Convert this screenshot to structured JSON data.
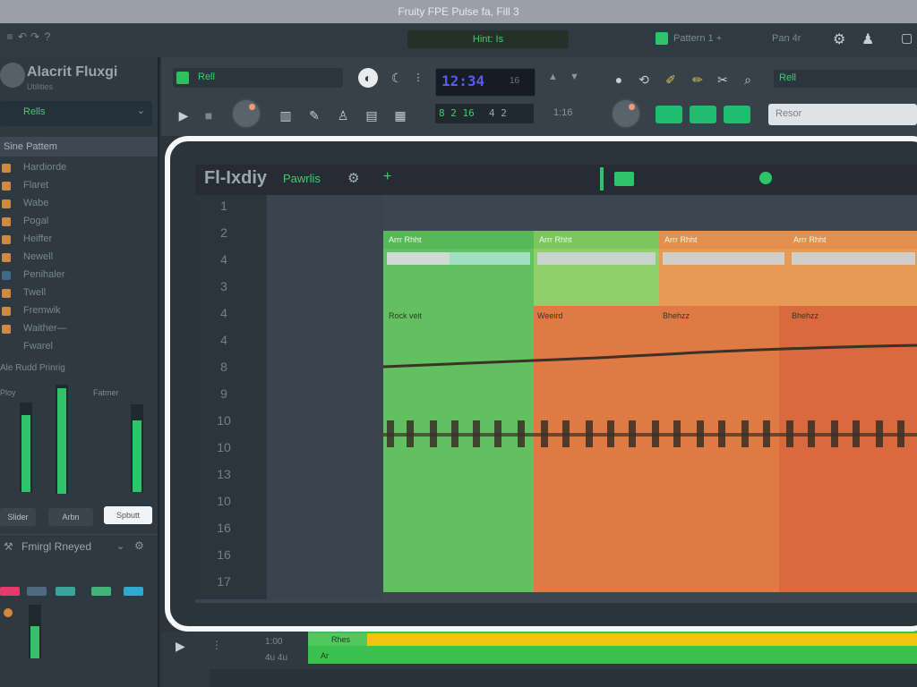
{
  "window": {
    "title": "Fruity FPE Pulse fa, Fill 3"
  },
  "topstrip": {
    "hint": "Hint: Is",
    "right_item_1": "Pattern 1 +",
    "right_item_2": "Pan 4r",
    "icons": [
      "menu-icon",
      "undo-icon",
      "redo-icon",
      "help-icon"
    ]
  },
  "browser": {
    "app_name": "Alacrit Fluxgi",
    "app_sub": "Utilities",
    "folder_value": "Rells",
    "header": "Sine Pattem",
    "items": [
      "Hardiorde",
      "Flaret",
      "Wabe",
      "Pogal",
      "Heiffer",
      "Newell",
      "Penihaler",
      "Twell",
      "Fremwik",
      "Waither—",
      "Fwarel"
    ],
    "mixer_label": "Ale Rudd Prinrig",
    "mix_col_1": "Ploy",
    "mix_col_2": "Fatmer",
    "btn_a": "Slider",
    "btn_b": "Arbn",
    "btn_c": "Spbutt",
    "preset_name": "Fmirgl Rneyed"
  },
  "toolbar": {
    "pattern_text": "Rell",
    "lcd_time": "12:34",
    "lcd_sub": "16",
    "lcd2_text": "8 2 16",
    "lcd2_extra": "4  2",
    "right_field": "Rell",
    "preset_placeholder": "Resor",
    "misc_label": "1:16"
  },
  "playlist": {
    "title": "Fl-Ixdiy",
    "pattern_label": "Pawrlis",
    "track_numbers": [
      "1",
      "2",
      "4",
      "3",
      "4",
      "4",
      "8",
      "9",
      "10",
      "10",
      "13",
      "10",
      "16",
      "16",
      "17"
    ],
    "clip_label": "Arrr Rhht",
    "lane_label_1": "Rock veit",
    "lane_label_2": "Weeird",
    "lane_label_3": "Bhehzz"
  },
  "bottom": {
    "time": "1:00",
    "time2": "4u 4u",
    "green_label": "Rhes",
    "green_label_2": "Ar"
  },
  "colors": {
    "accent_green": "#2fc36b",
    "clip_green": "#63c060",
    "clip_orange": "#e0884b",
    "clip_dark_orange": "#d96a3d",
    "lcd_blue": "#5a5cf0",
    "timeline_yellow": "#f1c40f"
  }
}
